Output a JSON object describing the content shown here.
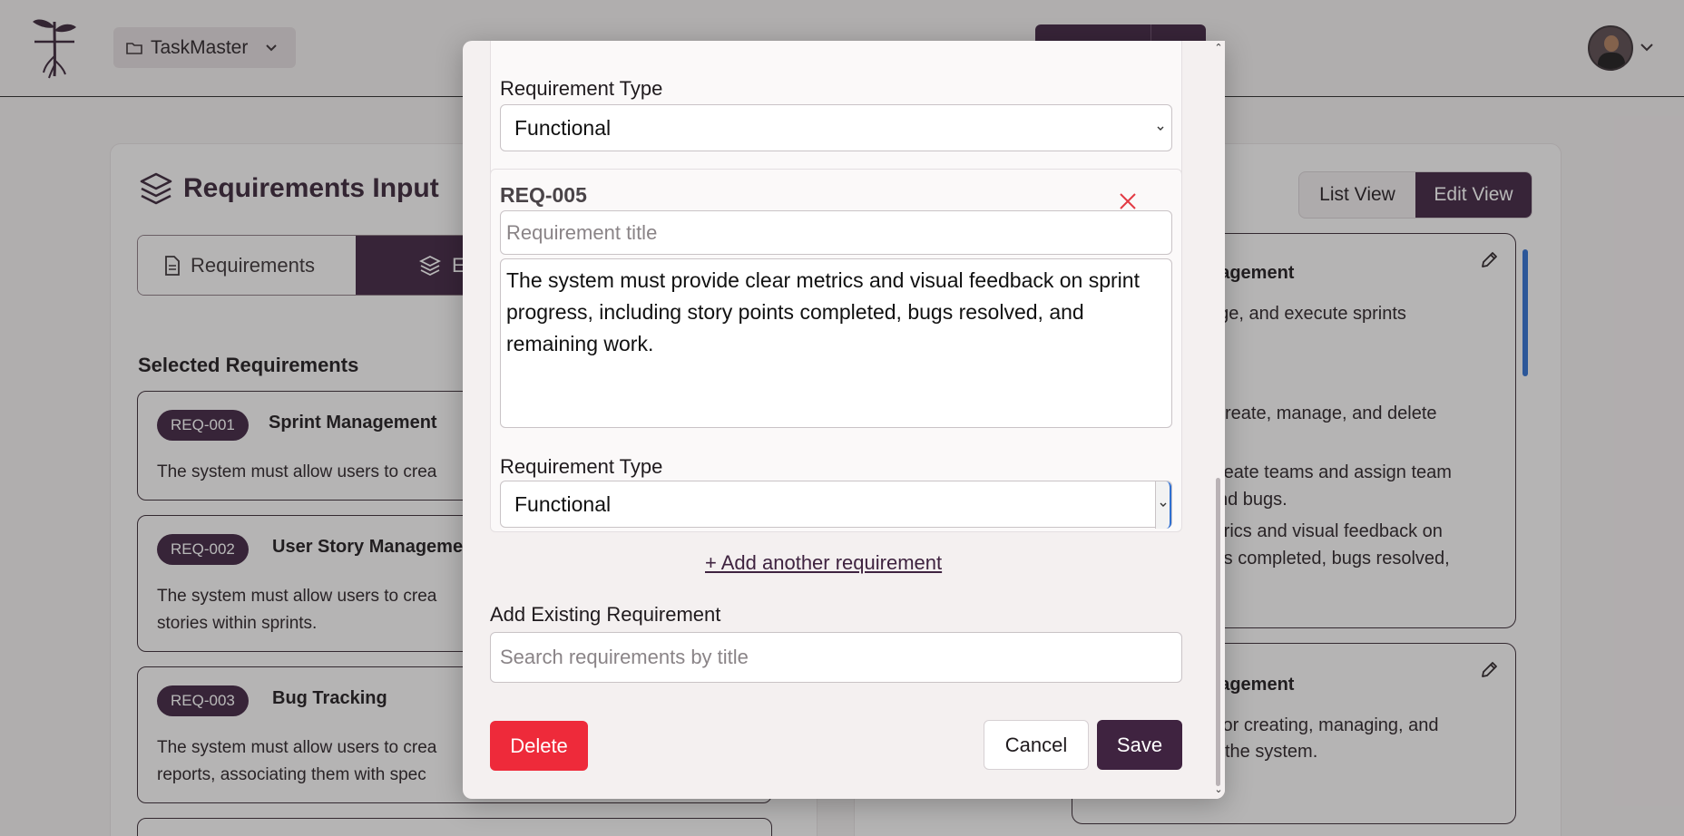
{
  "header": {
    "project_name": "TaskMaster"
  },
  "left_panel": {
    "title": "Requirements Input",
    "tabs": [
      {
        "label": "Requirements"
      },
      {
        "label": "E"
      }
    ],
    "selected_title": "Selected Requirements",
    "requirements": [
      {
        "id": "REQ-001",
        "title": "Sprint Management",
        "lines": [
          "The system must allow users to crea"
        ]
      },
      {
        "id": "REQ-002",
        "title": "User Story Manageme",
        "lines": [
          "The system must allow users to crea",
          "stories within sprints."
        ]
      },
      {
        "id": "REQ-003",
        "title": "Bug Tracking",
        "lines": [
          "The system must allow users to crea",
          "reports, associating them with spec"
        ]
      }
    ]
  },
  "right_panel": {
    "list_view_label": "List View",
    "edit_view_label": "Edit View",
    "cards": [
      {
        "title": "nagement",
        "lines": [
          "age, and execute sprints",
          "create, manage, and delete",
          "reate teams and assign team",
          "nd bugs.",
          "etrics and visual feedback on",
          "nts completed, bugs resolved,"
        ]
      },
      {
        "title": "nagement",
        "lines": [
          "for creating, managing, and",
          "the system."
        ]
      }
    ]
  },
  "modal": {
    "previous_type_label": "Requirement Type",
    "previous_type_value": "Functional",
    "requirement": {
      "id": "REQ-005",
      "title_placeholder": "Requirement title",
      "description": "The system must provide clear metrics and visual feedback on sprint progress, including story points completed, bugs resolved, and remaining work.",
      "type_label": "Requirement Type",
      "type_value": "Functional"
    },
    "add_another_label": "+ Add another requirement",
    "existing_label": "Add Existing Requirement",
    "search_placeholder": "Search requirements by title",
    "delete_label": "Delete",
    "cancel_label": "Cancel",
    "save_label": "Save"
  },
  "colors": {
    "brand": "#3f2340",
    "danger": "#ee2a3a",
    "overlay": "#282628"
  }
}
